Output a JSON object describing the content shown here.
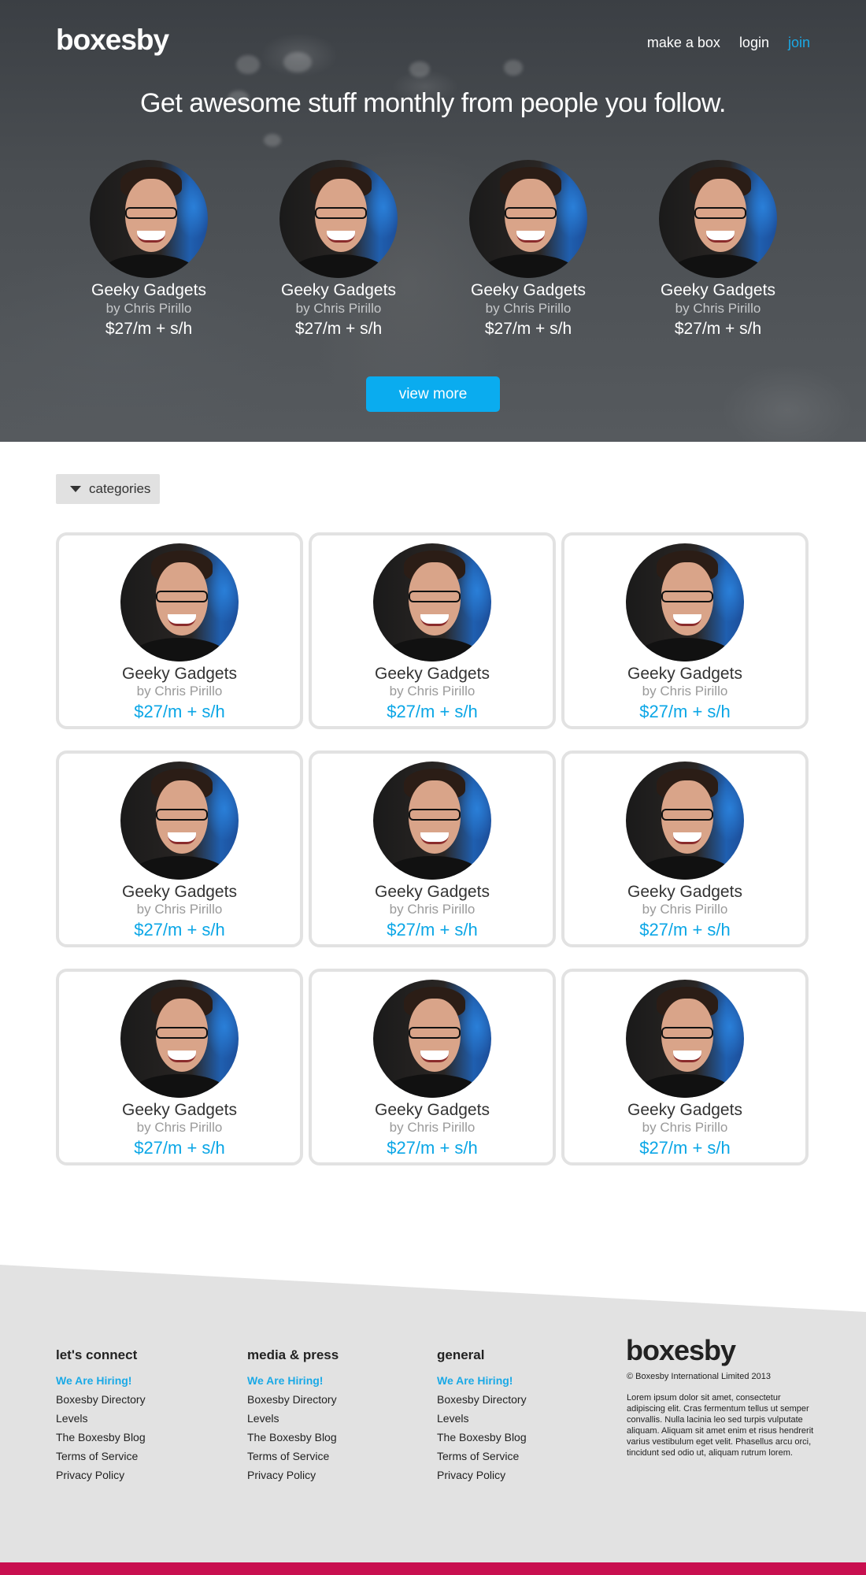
{
  "header": {
    "logo": "boxesby",
    "nav": [
      "make a box",
      "login",
      "join"
    ],
    "accent_color": "#1aa9e6"
  },
  "hero": {
    "headline": "Get awesome stuff monthly from people you follow.",
    "featured": [
      {
        "title": "Geeky Gadgets",
        "by": "by Chris Pirillo",
        "price": "$27/m + s/h"
      },
      {
        "title": "Geeky Gadgets",
        "by": "by Chris Pirillo",
        "price": "$27/m + s/h"
      },
      {
        "title": "Geeky Gadgets",
        "by": "by Chris Pirillo",
        "price": "$27/m + s/h"
      },
      {
        "title": "Geeky Gadgets",
        "by": "by Chris Pirillo",
        "price": "$27/m + s/h"
      }
    ],
    "view_more_label": "view more"
  },
  "categories_label": "categories",
  "boxes": [
    {
      "title": "Geeky Gadgets",
      "by": "by Chris Pirillo",
      "price": "$27/m + s/h"
    },
    {
      "title": "Geeky Gadgets",
      "by": "by Chris Pirillo",
      "price": "$27/m + s/h"
    },
    {
      "title": "Geeky Gadgets",
      "by": "by Chris Pirillo",
      "price": "$27/m + s/h"
    },
    {
      "title": "Geeky Gadgets",
      "by": "by Chris Pirillo",
      "price": "$27/m + s/h"
    },
    {
      "title": "Geeky Gadgets",
      "by": "by Chris Pirillo",
      "price": "$27/m + s/h"
    },
    {
      "title": "Geeky Gadgets",
      "by": "by Chris Pirillo",
      "price": "$27/m + s/h"
    },
    {
      "title": "Geeky Gadgets",
      "by": "by Chris Pirillo",
      "price": "$27/m + s/h"
    },
    {
      "title": "Geeky Gadgets",
      "by": "by Chris Pirillo",
      "price": "$27/m + s/h"
    },
    {
      "title": "Geeky Gadgets",
      "by": "by Chris Pirillo",
      "price": "$27/m + s/h"
    }
  ],
  "footer": {
    "columns": [
      {
        "heading": "let's connect",
        "links": [
          "We Are Hiring!",
          "Boxesby Directory",
          "Levels",
          "The Boxesby Blog",
          "Terms of Service",
          "Privacy Policy"
        ]
      },
      {
        "heading": "media & press",
        "links": [
          "We Are Hiring!",
          "Boxesby Directory",
          "Levels",
          "The Boxesby Blog",
          "Terms of Service",
          "Privacy Policy"
        ]
      },
      {
        "heading": "general",
        "links": [
          "We Are Hiring!",
          "Boxesby Directory",
          "Levels",
          "The Boxesby Blog",
          "Terms of Service",
          "Privacy Policy"
        ]
      }
    ],
    "logo": "boxesby",
    "copyright": "© Boxesby International Limited 2013",
    "lorem": "Lorem ipsum dolor sit amet, consectetur adipiscing elit. Cras fermentum tellus ut semper convallis. Nulla lacinia leo sed turpis vulputate aliquam. Aliquam sit amet enim et risus hendrerit varius vestibulum eget velit. Phasellus arcu orci, tincidunt sed odio ut, aliquam rutrum lorem.",
    "bar_color": "#c80f4f"
  }
}
